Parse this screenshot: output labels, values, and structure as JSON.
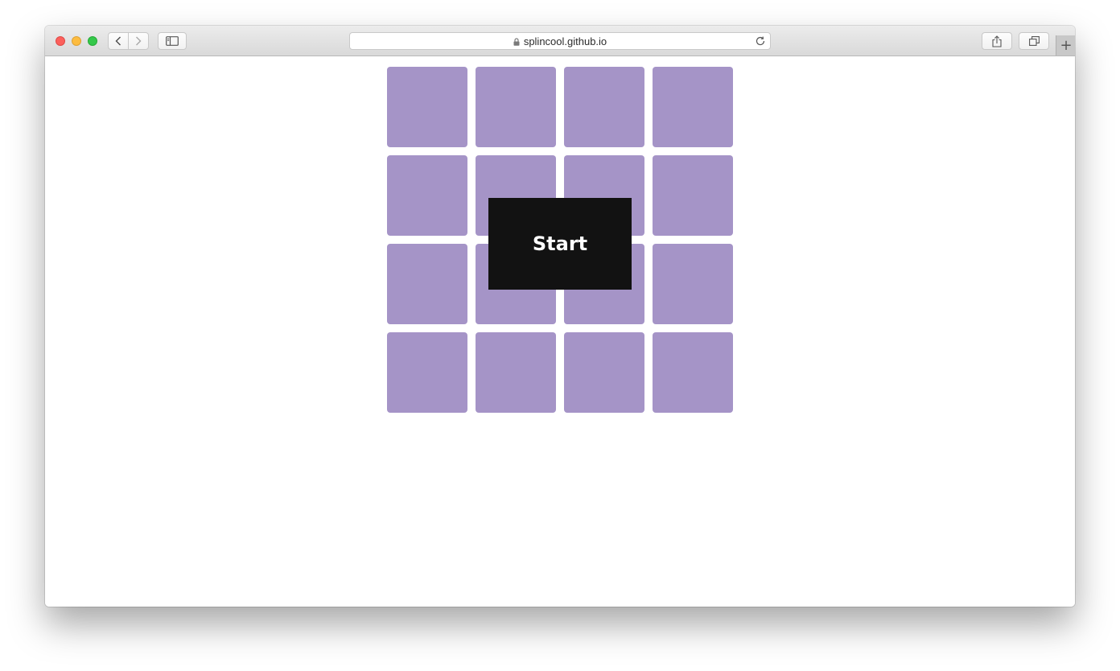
{
  "browser": {
    "url": "splincool.github.io",
    "new_tab_label": "+"
  },
  "game": {
    "tile_color": "#a594c7",
    "tile_count": 16,
    "start_label": "Start"
  }
}
